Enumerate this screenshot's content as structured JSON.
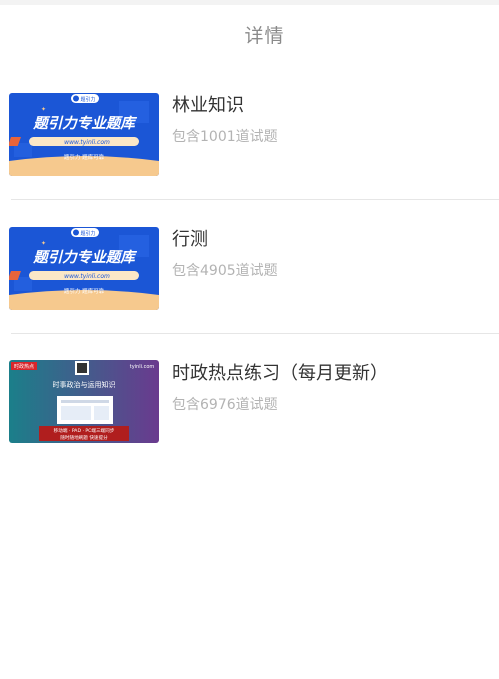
{
  "header": {
    "title": "详情"
  },
  "items": [
    {
      "title": "林业知识",
      "count": "包含1001道试题",
      "thumb": {
        "type": "brand",
        "headline": "题引力专业题库",
        "url": "www.tyinli.com",
        "tagline": "题引力 题库可靠",
        "logo": "题引力",
        "colors": {
          "bg": "#1b56d6",
          "band": "#f6c98e",
          "pill": "#fbe7c7"
        }
      }
    },
    {
      "title": "行测",
      "count": "包含4905道试题",
      "thumb": {
        "type": "brand",
        "headline": "题引力专业题库",
        "url": "www.tyinli.com",
        "tagline": "题引力 题库可靠",
        "logo": "题引力",
        "colors": {
          "bg": "#1b56d6",
          "band": "#f6c98e",
          "pill": "#fbe7c7"
        }
      }
    },
    {
      "title": "时政热点练习（每月更新）",
      "count": "包含6976道试题",
      "thumb": {
        "type": "politics",
        "badge": "时政热点",
        "heading": "时事政治与运用知识",
        "site": "tyinli.com",
        "line1": "移动端 · PAD · PC端三端同步",
        "line2": "随时随地刷题 快速提分",
        "colors": {
          "left": "#1b7f8a",
          "right": "#6a3a8e",
          "banner": "#b01e1e",
          "badge": "#d8262b"
        }
      }
    }
  ]
}
